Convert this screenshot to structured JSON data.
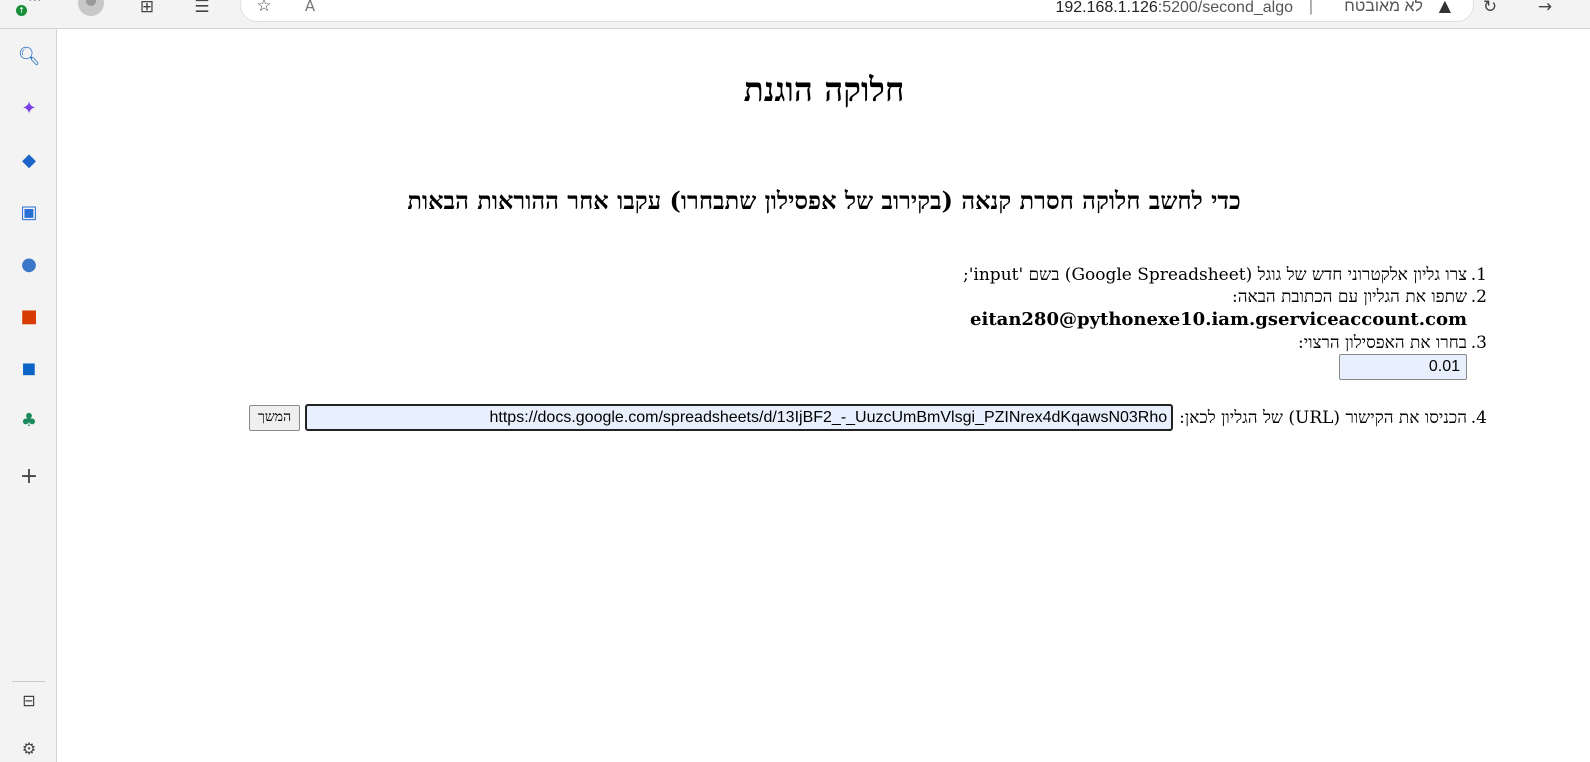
{
  "browser": {
    "address_host": "192.168.1.126",
    "address_rest": ":5200/second_algo",
    "security_label": "לא מאובטח",
    "separator": "|"
  },
  "icons": {
    "toolbar": [
      "profile-icon",
      "new-tab-icon",
      "collections-icon",
      "favorites-icon",
      "read-aloud-icon",
      "refresh-icon",
      "back-icon"
    ],
    "sidebar": [
      "search-icon",
      "copilot-icon",
      "shopping-icon",
      "tools-icon",
      "games-icon",
      "office-icon",
      "outlook-icon",
      "tree-icon",
      "add-icon",
      "sidebar-collapse-icon",
      "settings-icon"
    ]
  },
  "page": {
    "title": "חלוקה הוגנת",
    "subtitle": "כדי לחשב חלוקה חסרת קנאה (בקירוב של אפסילון שתבחרו) עקבו אחר ההוראות הבאות",
    "steps": {
      "step1_num": "1.",
      "step1_text": "צרו גליון אלקטרוני חדש של גוגל (Google Spreadsheet) בשם 'input';",
      "step2_num": "2.",
      "step2_text": "שתפו את הגליון עם הכתובת הבאה:",
      "email": "eitan280@pythonexe10.iam.gserviceaccount.com",
      "step3_num": "3.",
      "step3_text": "בחרו את האפסילון הרצוי:",
      "epsilon_value": "0.01",
      "step4_num": "4.",
      "step4_text": "הכניסו את הקישור (URL) של הגליון לכאן:",
      "url_value": "https://docs.google.com/spreadsheets/d/13IjBF2_-_UuzcUmBmVlsgi_PZINrex4dKqawsN03Rho",
      "next_button": "המשך"
    }
  }
}
